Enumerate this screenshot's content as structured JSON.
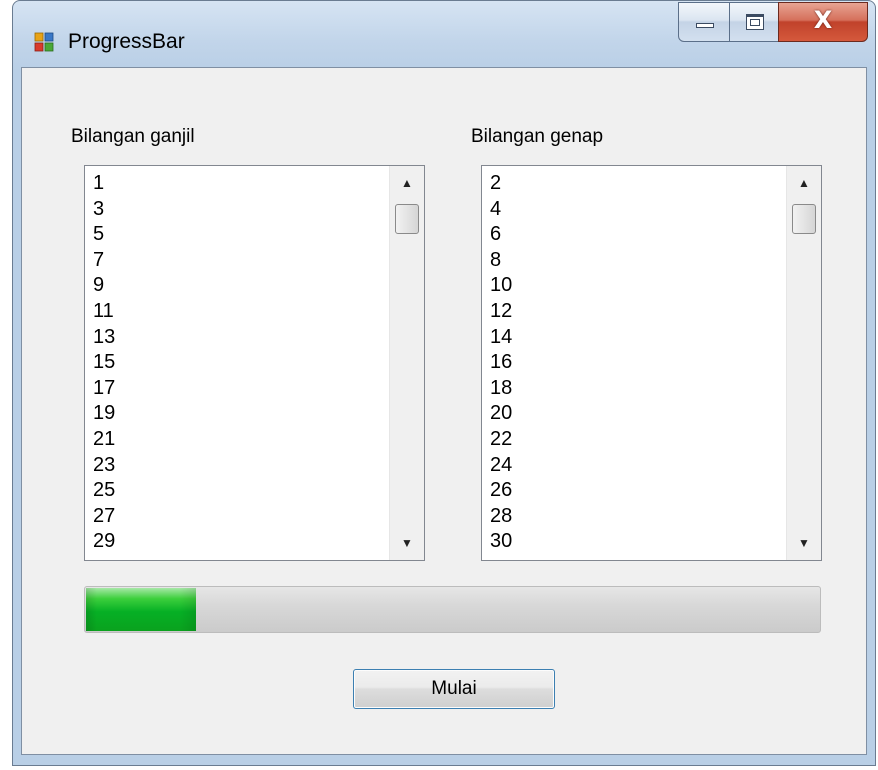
{
  "window": {
    "title": "ProgressBar",
    "close_glyph": "X",
    "icons": {
      "app": "app-icon",
      "minimize": "minimize-icon",
      "maximize": "maximize-icon",
      "close": "close-icon"
    }
  },
  "odd_list": {
    "label": "Bilangan ganjil",
    "items": [
      "1",
      "3",
      "5",
      "7",
      "9",
      "11",
      "13",
      "15",
      "17",
      "19",
      "21",
      "23",
      "25",
      "27",
      "29"
    ]
  },
  "even_list": {
    "label": "Bilangan genap",
    "items": [
      "2",
      "4",
      "6",
      "8",
      "10",
      "12",
      "14",
      "16",
      "18",
      "20",
      "22",
      "24",
      "26",
      "28",
      "30"
    ]
  },
  "progress": {
    "value": 0.15,
    "color": "#06b025"
  },
  "button": {
    "label": "Mulai"
  },
  "colors": {
    "client_bg": "#f0f0f0",
    "button_border": "#3c7fb1",
    "close_red": "#c0422b"
  }
}
